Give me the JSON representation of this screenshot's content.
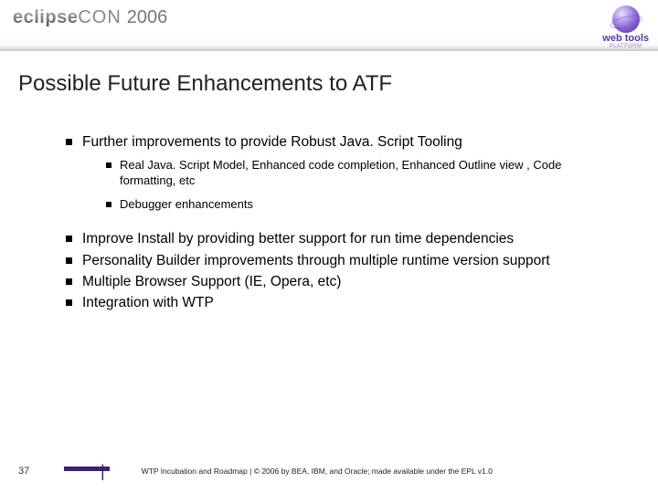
{
  "header": {
    "logo_left": {
      "brand_dark": "eclipse",
      "brand_light": "CON",
      "year": "2006"
    },
    "logo_right": {
      "line1": "web tools",
      "line2": "PLATFORM"
    }
  },
  "title": "Possible Future Enhancements to ATF",
  "bullets": [
    {
      "text": "Further improvements to provide Robust Java. Script Tooling",
      "children": [
        "Real Java. Script Model, Enhanced code completion, Enhanced Outline view , Code formatting, etc",
        "Debugger enhancements"
      ]
    },
    {
      "text": "Improve Install by providing better support for run time dependencies"
    },
    {
      "text": "Personality Builder improvements through multiple runtime version support"
    },
    {
      "text": "Multiple Browser Support (IE, Opera, etc)"
    },
    {
      "text": "Integration with WTP"
    }
  ],
  "footer": {
    "page": "37",
    "text": "WTP Incubation and Roadmap  |  © 2006 by BEA, IBM, and Oracle; made available under the EPL v1.0"
  }
}
